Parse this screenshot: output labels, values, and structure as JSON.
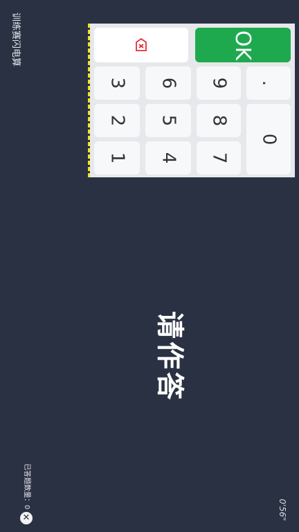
{
  "app": {
    "title": "训练赛闪电算"
  },
  "main": {
    "prompt": "请作答"
  },
  "status": {
    "answered_label": "已答题数量：0",
    "timer": "0'56\""
  },
  "keypad": {
    "ok_label": "OK",
    "keys": {
      "k1": "1",
      "k2": "2",
      "k3": "3",
      "k4": "4",
      "k5": "5",
      "k6": "6",
      "k7": "7",
      "k8": "8",
      "k9": "9",
      "k0": "0",
      "dot": "."
    }
  },
  "colors": {
    "background": "#2a3142",
    "ok": "#1ea94f",
    "delete_icon": "#e0303a",
    "accent_line": "#f4e21c"
  }
}
